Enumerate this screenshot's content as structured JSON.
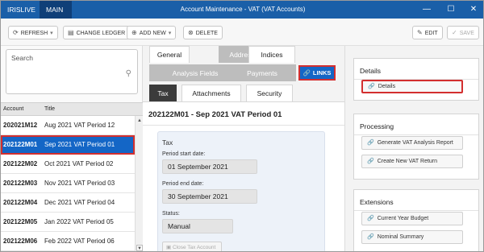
{
  "app": {
    "brand": "IRISLIVE",
    "main_tab": "MAIN",
    "window_title": "Account Maintenance - VAT (VAT Accounts)"
  },
  "toolbar": {
    "refresh": "REFRESH",
    "change_ledger": "CHANGE LEDGER",
    "add_new": "ADD NEW",
    "delete": "DELETE",
    "edit": "EDIT",
    "save": "SAVE"
  },
  "search": {
    "placeholder": "Search"
  },
  "list": {
    "col_account": "Account",
    "col_title": "Title",
    "rows": [
      {
        "code": "202021M12",
        "title": "Aug 2021 VAT Period 12"
      },
      {
        "code": "202122M01",
        "title": "Sep 2021 VAT Period 01"
      },
      {
        "code": "202122M02",
        "title": "Oct 2021 VAT Period 02"
      },
      {
        "code": "202122M03",
        "title": "Nov 2021 VAT Period 03"
      },
      {
        "code": "202122M04",
        "title": "Dec 2021 VAT Period 04"
      },
      {
        "code": "202122M05",
        "title": "Jan 2022 VAT Period 05"
      },
      {
        "code": "202122M06",
        "title": "Feb 2022 VAT Period 06"
      }
    ],
    "selected_index": 1
  },
  "tabs": {
    "general": "General",
    "address": "Address",
    "indices": "Indices",
    "analysis_fields": "Analysis Fields",
    "payments": "Payments",
    "links": "LINKS",
    "tax": "Tax",
    "attachments": "Attachments",
    "security": "Security"
  },
  "record": {
    "heading": "202122M01 - Sep 2021 VAT Period 01",
    "section": "Tax",
    "period_start_label": "Period start date:",
    "period_start_value": "01 September 2021",
    "period_end_label": "Period end date:",
    "period_end_value": "30 September 2021",
    "status_label": "Status:",
    "status_value": "Manual",
    "close_button": "Close Tax Account"
  },
  "right_panel": {
    "details": {
      "title": "Details",
      "buttons": [
        "Details"
      ]
    },
    "processing": {
      "title": "Processing",
      "buttons": [
        "Generate VAT Analysis Report",
        "Create New VAT Return"
      ]
    },
    "extensions": {
      "title": "Extensions",
      "buttons": [
        "Current Year Budget",
        "Nominal Summary"
      ]
    }
  },
  "colors": {
    "titlebar": "#1a5fa8",
    "selection": "#1466c6",
    "highlight": "#d32f2f"
  }
}
